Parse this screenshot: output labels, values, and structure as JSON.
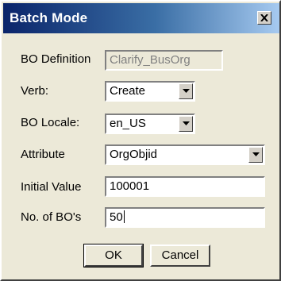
{
  "window": {
    "title": "Batch Mode",
    "close_glyph": "close-icon"
  },
  "form": {
    "bo_definition": {
      "label": "BO Definition",
      "value": "Clarify_BusOrg"
    },
    "verb": {
      "label": "Verb:",
      "value": "Create"
    },
    "bo_locale": {
      "label": "BO Locale:",
      "value": "en_US"
    },
    "attribute": {
      "label": "Attribute",
      "value": "OrgObjid"
    },
    "initial_value": {
      "label": "Initial Value",
      "value": "100001"
    },
    "num_bos": {
      "label": "No. of BO's",
      "value": "50"
    }
  },
  "buttons": {
    "ok_label": "OK",
    "cancel_label": "Cancel"
  },
  "colors": {
    "title_gradient_start": "#0a246a",
    "title_gradient_end": "#a6caf0",
    "dialog_background": "#ece9d8"
  }
}
